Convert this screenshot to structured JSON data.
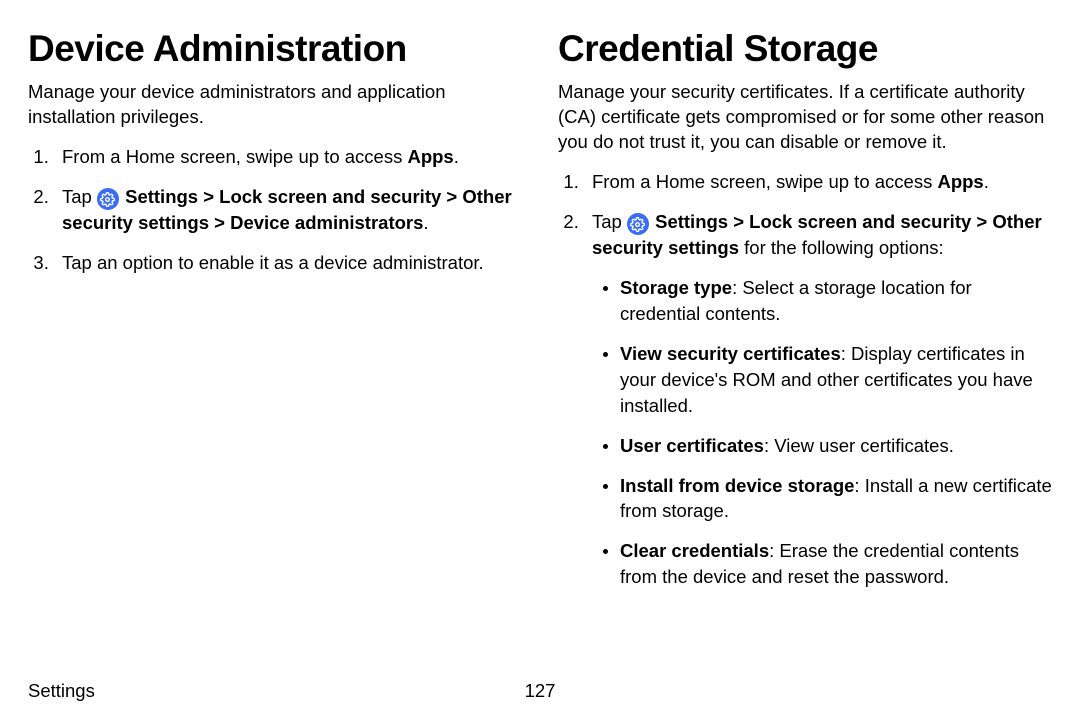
{
  "left": {
    "title": "Device Administration",
    "intro": "Manage your device administrators and application installation privileges.",
    "step1_a": "From a Home screen, swipe up to access ",
    "step1_b": "Apps",
    "step1_c": ".",
    "step2_a": "Tap ",
    "step2_b": " Settings > Lock screen and security > Other security settings > Device administrators",
    "step2_c": ".",
    "step3": "Tap an option to enable it as a device administrator."
  },
  "right": {
    "title": "Credential Storage",
    "intro": "Manage your security certificates. If a certificate authority (CA) certificate gets compromised or for some other reason you do not trust it, you can disable or remove it.",
    "step1_a": "From a Home screen, swipe up to access ",
    "step1_b": "Apps",
    "step1_c": ".",
    "step2_a": "Tap ",
    "step2_b": " Settings > Lock screen and security > Other security settings",
    "step2_c": " for the following options:",
    "opts": {
      "o1_b": "Storage type",
      "o1_t": ": Select a storage location for credential contents.",
      "o2_b": "View security certificates",
      "o2_t": ": Display certificates in your device's ROM and other certificates you have installed.",
      "o3_b": "User certificates",
      "o3_t": ": View user certificates.",
      "o4_b": "Install from device storage",
      "o4_t": ": Install a new certificate from storage.",
      "o5_b": "Clear credentials",
      "o5_t": ": Erase the credential contents from the device and reset the password."
    }
  },
  "footer": {
    "section": "Settings",
    "page": "127"
  }
}
